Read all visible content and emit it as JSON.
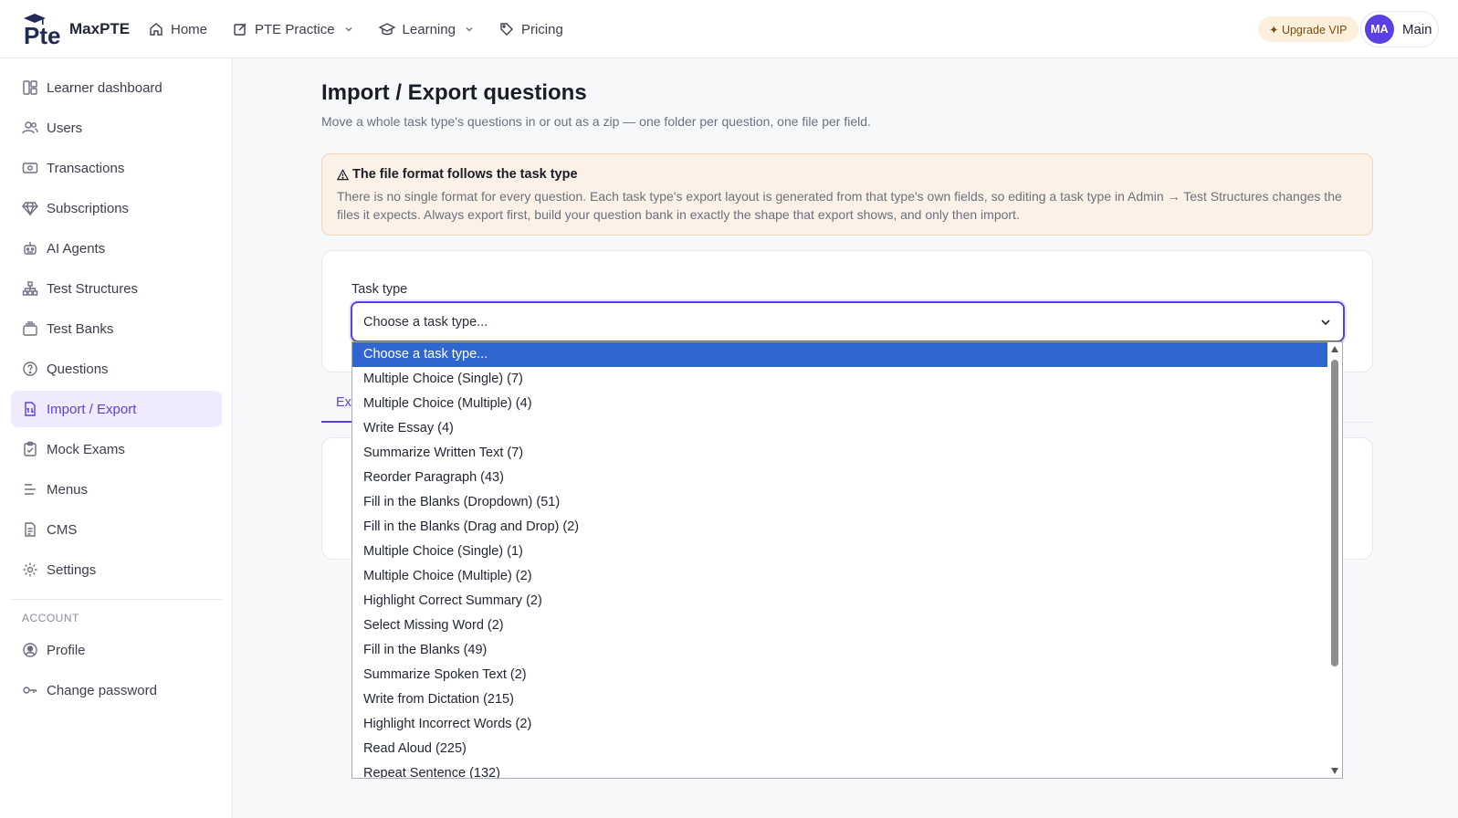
{
  "app": {
    "brand": "MaxPTE",
    "logo_text": "Pte"
  },
  "topnav": [
    {
      "label": "Home",
      "icon": "home-icon"
    },
    {
      "label": "PTE Practice",
      "icon": "edit-icon",
      "dropdown": true
    },
    {
      "label": "Learning",
      "icon": "graduation-cap-icon",
      "dropdown": true
    },
    {
      "label": "Pricing",
      "icon": "tag-icon"
    }
  ],
  "upgrade_label": "✦ Upgrade VIP",
  "user": {
    "initials": "MA",
    "name": "Main"
  },
  "sidebar": {
    "items": [
      {
        "label": "Learner dashboard",
        "icon": "dashboard-icon"
      },
      {
        "label": "Users",
        "icon": "users-icon"
      },
      {
        "label": "Transactions",
        "icon": "money-icon"
      },
      {
        "label": "Subscriptions",
        "icon": "diamond-icon"
      },
      {
        "label": "AI Agents",
        "icon": "robot-icon"
      },
      {
        "label": "Test Structures",
        "icon": "hierarchy-icon"
      },
      {
        "label": "Test Banks",
        "icon": "layers-icon"
      },
      {
        "label": "Questions",
        "icon": "question-icon"
      },
      {
        "label": "Import / Export",
        "icon": "file-transfer-icon",
        "active": true
      },
      {
        "label": "Mock Exams",
        "icon": "clipboard-icon"
      },
      {
        "label": "Menus",
        "icon": "menu-icon"
      },
      {
        "label": "CMS",
        "icon": "document-icon"
      },
      {
        "label": "Settings",
        "icon": "gear-icon"
      }
    ],
    "account_section": "ACCOUNT",
    "account_items": [
      {
        "label": "Profile",
        "icon": "user-circle-icon"
      },
      {
        "label": "Change password",
        "icon": "key-icon"
      }
    ]
  },
  "main": {
    "title": "Import / Export questions",
    "subtitle": "Move a whole task type's questions in or out as a zip — one folder per question, one file per field.",
    "alert": {
      "title": "The file format follows the task type",
      "body": "There is no single format for every question. Each task type's export layout is generated from that type's own fields, so editing a task type in Admin → Test Structures changes the files it expects. Always export first, build your question bank in exactly the shape that export shows, and only then import."
    },
    "task_type_label": "Task type",
    "task_type_value": "Choose a task type...",
    "tab_export": "Ex"
  },
  "dropdown": {
    "options": [
      "Choose a task type...",
      "Multiple Choice (Single) (7)",
      "Multiple Choice (Multiple) (4)",
      "Write Essay (4)",
      "Summarize Written Text (7)",
      "Reorder Paragraph (43)",
      "Fill in the Blanks (Dropdown) (51)",
      "Fill in the Blanks (Drag and Drop) (2)",
      "Multiple Choice (Single) (1)",
      "Multiple Choice (Multiple) (2)",
      "Highlight Correct Summary (2)",
      "Select Missing Word (2)",
      "Fill in the Blanks (49)",
      "Summarize Spoken Text (2)",
      "Write from Dictation (215)",
      "Highlight Incorrect Words (2)",
      "Read Aloud (225)",
      "Repeat Sentence (132)"
    ],
    "selected_index": 0
  },
  "colors": {
    "accent": "#5b3fe0",
    "active_bg": "#efebfd",
    "selected_option": "#3066d0",
    "alert_bg": "#fcf1e6"
  }
}
